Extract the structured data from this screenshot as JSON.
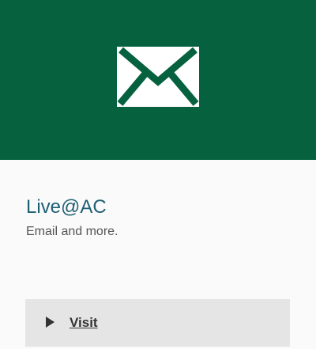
{
  "app": {
    "title": "Live@AC",
    "description": "Email and more.",
    "icon": "envelope-icon",
    "colors": {
      "hero_background": "#06613f",
      "title_text": "#1f5f73",
      "button_background": "#e5e5e5"
    }
  },
  "action": {
    "label": "Visit",
    "icon": "play-triangle-icon"
  }
}
